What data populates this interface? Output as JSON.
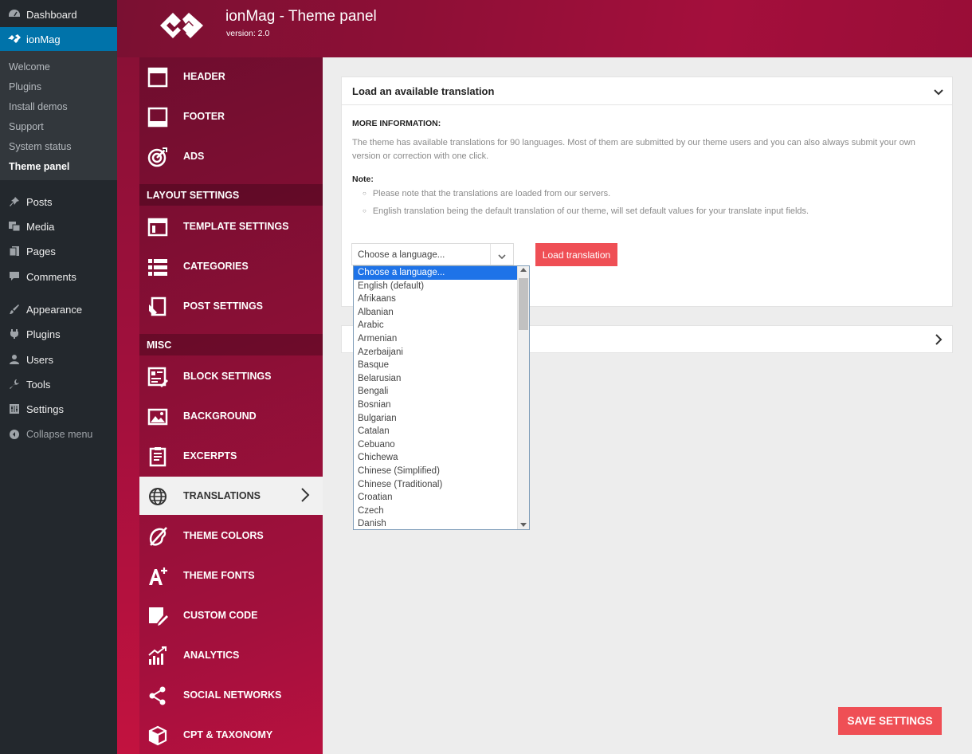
{
  "wp_menu": {
    "top_items": [
      {
        "label": "Dashboard",
        "icon": "dashboard-icon"
      },
      {
        "label": "ionMag",
        "icon": "ionmag-logo-icon"
      }
    ],
    "sub_items": [
      {
        "label": "Welcome"
      },
      {
        "label": "Plugins"
      },
      {
        "label": "Install demos"
      },
      {
        "label": "Support"
      },
      {
        "label": "System status"
      },
      {
        "label": "Theme panel"
      }
    ],
    "items": [
      {
        "label": "Posts",
        "icon": "pin-icon"
      },
      {
        "label": "Media",
        "icon": "media-icon"
      },
      {
        "label": "Pages",
        "icon": "pages-icon"
      },
      {
        "label": "Comments",
        "icon": "comments-icon"
      },
      {
        "label": "Appearance",
        "icon": "brush-icon"
      },
      {
        "label": "Plugins",
        "icon": "plugin-icon"
      },
      {
        "label": "Users",
        "icon": "user-icon"
      },
      {
        "label": "Tools",
        "icon": "wrench-icon"
      },
      {
        "label": "Settings",
        "icon": "settings-icon"
      },
      {
        "label": "Collapse menu",
        "icon": "collapse-icon"
      }
    ]
  },
  "header": {
    "title": "ionMag - Theme panel",
    "version": "version: 2.0"
  },
  "theme_nav": {
    "items_top": [
      {
        "label": "HEADER",
        "icon": "header-icon"
      },
      {
        "label": "FOOTER",
        "icon": "footer-icon"
      },
      {
        "label": "ADS",
        "icon": "target-icon"
      }
    ],
    "section_layout": "LAYOUT SETTINGS",
    "items_layout": [
      {
        "label": "TEMPLATE SETTINGS",
        "icon": "template-icon"
      },
      {
        "label": "CATEGORIES",
        "icon": "list-icon"
      },
      {
        "label": "POST SETTINGS",
        "icon": "post-settings-icon"
      }
    ],
    "section_misc": "MISC",
    "items_misc": [
      {
        "label": "BLOCK SETTINGS",
        "icon": "block-settings-icon"
      },
      {
        "label": "BACKGROUND",
        "icon": "image-icon"
      },
      {
        "label": "EXCERPTS",
        "icon": "excerpt-icon"
      },
      {
        "label": "TRANSLATIONS",
        "icon": "globe-icon"
      },
      {
        "label": "THEME COLORS",
        "icon": "color-icon"
      },
      {
        "label": "THEME FONTS",
        "icon": "font-icon"
      },
      {
        "label": "CUSTOM CODE",
        "icon": "code-icon"
      },
      {
        "label": "ANALYTICS",
        "icon": "analytics-icon"
      },
      {
        "label": "SOCIAL NETWORKS",
        "icon": "share-icon"
      },
      {
        "label": "CPT & TAXONOMY",
        "icon": "cube-icon"
      }
    ]
  },
  "translation_panel": {
    "title": "Load an available translation",
    "more_info_label": "MORE INFORMATION:",
    "description": "The theme has available translations for 90 languages. Most of them are submitted by our theme users and you can also always submit your own version or correction with one click.",
    "note_label": "Note:",
    "notes": [
      "Please note that the translations are loaded from our servers.",
      "English translation being the default translation of our theme, will set default values for your translate input fields."
    ],
    "select_value": "Choose a language...",
    "load_button": "Load translation",
    "options": [
      "Choose a language...",
      "English (default)",
      "Afrikaans",
      "Albanian",
      "Arabic",
      "Armenian",
      "Azerbaijani",
      "Basque",
      "Belarusian",
      "Bengali",
      "Bosnian",
      "Bulgarian",
      "Catalan",
      "Cebuano",
      "Chichewa",
      "Chinese (Simplified)",
      "Chinese (Traditional)",
      "Croatian",
      "Czech",
      "Danish"
    ]
  },
  "save_button": "SAVE SETTINGS"
}
